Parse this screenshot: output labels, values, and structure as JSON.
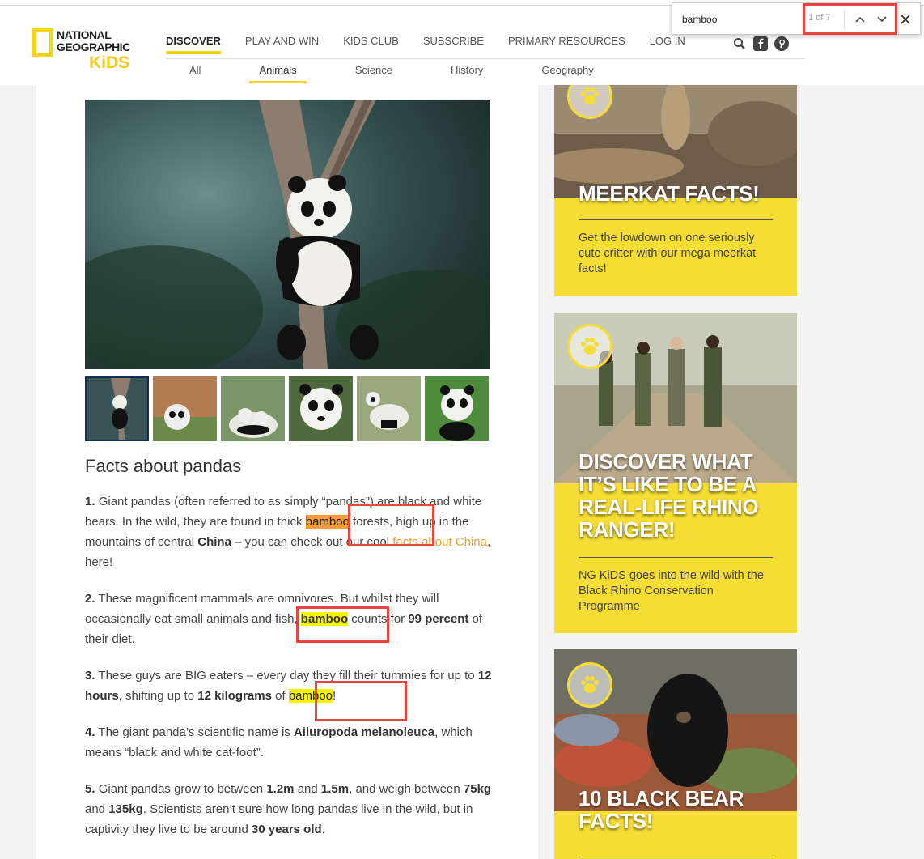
{
  "logo": {
    "line1": "NATIONAL",
    "line2": "GEOGRAPHIC",
    "line3": "KiDS"
  },
  "nav": {
    "items": [
      "DISCOVER",
      "PLAY AND WIN",
      "KIDS CLUB",
      "SUBSCRIBE",
      "PRIMARY RESOURCES",
      "LOG IN"
    ],
    "active": "DISCOVER"
  },
  "subnav": {
    "items": [
      "All",
      "Animals",
      "Science",
      "History",
      "Geography"
    ],
    "active": "Animals"
  },
  "findbar": {
    "query": "bamboo",
    "count": "1 of 7"
  },
  "article": {
    "heading": "Facts about pandas",
    "facts": [
      {
        "num": "1.",
        "parts": [
          "Giant pandas (often referred to as simply “pandas”) are black and white bears. In the wild, they are found in thick ",
          "bamboo",
          " forests, high up in the mountains of central ",
          "China",
          " – you can check out our cool ",
          "facts about China",
          ", here!"
        ]
      },
      {
        "num": "2.",
        "parts": [
          "These magnificent mammals are omnivores. But whilst they will occasionally eat small animals and fish, ",
          "bamboo",
          " counts for ",
          "99 percent",
          " of their diet."
        ]
      },
      {
        "num": "3.",
        "parts": [
          "These guys are BIG eaters – every day they fill their tummies for up to ",
          "12 hours",
          ", shifting up to ",
          "12 kilograms",
          " of ",
          "bamboo",
          "!"
        ]
      },
      {
        "num": "4.",
        "parts": [
          "The giant panda’s scientific name is ",
          "Ailuropoda melanoleuca",
          ", which means “black and white cat-foot”."
        ]
      },
      {
        "num": "5.",
        "parts": [
          "Giant pandas grow to between ",
          "1.2m",
          " and ",
          "1.5m",
          ", and weigh between ",
          "75kg",
          " and ",
          "135kg",
          ". Scientists aren’t sure how long pandas live in the wild, but in captivity they live to be around ",
          "30 years old",
          "."
        ]
      }
    ]
  },
  "sidebar": {
    "cards": [
      {
        "title": "MEERKAT FACTS!",
        "text": "Get the lowdown on one seriously cute critter with our mega meerkat facts!"
      },
      {
        "title": "DISCOVER WHAT IT’S LIKE TO BE A REAL-LIFE RHINO RANGER!",
        "text": "NG KiDS goes into the wild with the Black Rhino Conservation Programme"
      },
      {
        "title": "10 BLACK BEAR FACTS!",
        "text": ""
      }
    ]
  },
  "colors": {
    "accent_yellow": "#f6dd33",
    "highlight_current": "#f39c3c",
    "highlight_match": "#f5f500",
    "annotation_red": "#e8453c",
    "link_orange": "#f0a030"
  }
}
